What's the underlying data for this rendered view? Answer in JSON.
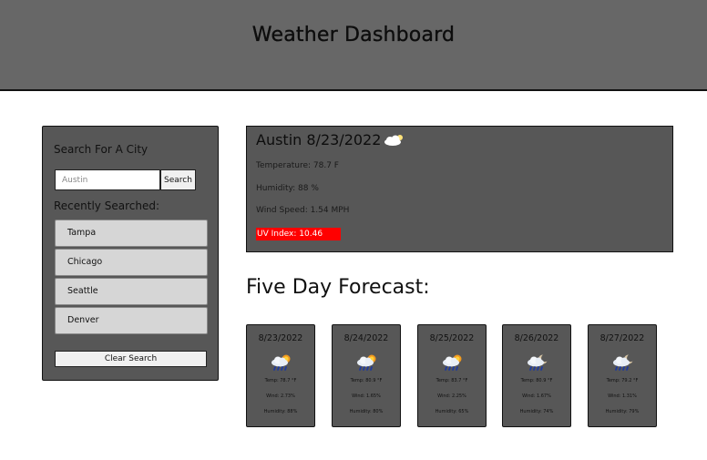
{
  "header": {
    "title": "Weather Dashboard"
  },
  "search": {
    "title": "Search For A City",
    "input_value": "Austin",
    "button_label": "Search",
    "recent_title": "Recently Searched:",
    "recent": [
      "Tampa",
      "Chicago",
      "Seattle",
      "Denver"
    ],
    "clear_label": "Clear Search"
  },
  "current": {
    "title": "Austin 8/23/2022",
    "icon": "cloud-icon",
    "temperature": "Temperature: 78.7 F",
    "humidity": "Humidity: 88 %",
    "wind": "Wind Speed: 1.54 MPH",
    "uv": "UV Index: 10.46",
    "uv_color": "#ff0000"
  },
  "forecast": {
    "title": "Five Day Forecast:",
    "days": [
      {
        "date": "8/23/2022",
        "icon": "rain-sun-icon",
        "temp": "Temp: 78.7 °F",
        "wind": "Wind: 2.73%",
        "humidity": "Humidity: 88%"
      },
      {
        "date": "8/24/2022",
        "icon": "rain-sun-icon",
        "temp": "Temp: 80.9 °F",
        "wind": "Wind: 1.65%",
        "humidity": "Humidity: 80%"
      },
      {
        "date": "8/25/2022",
        "icon": "rain-sun-icon",
        "temp": "Temp: 83.7 °F",
        "wind": "Wind: 2.25%",
        "humidity": "Humidity: 65%"
      },
      {
        "date": "8/26/2022",
        "icon": "rain-moon-icon",
        "temp": "Temp: 80.9 °F",
        "wind": "Wind: 1.67%",
        "humidity": "Humidity: 74%"
      },
      {
        "date": "8/27/2022",
        "icon": "rain-moon-icon",
        "temp": "Temp: 79.2 °F",
        "wind": "Wind: 1.31%",
        "humidity": "Humidity: 79%"
      }
    ]
  }
}
